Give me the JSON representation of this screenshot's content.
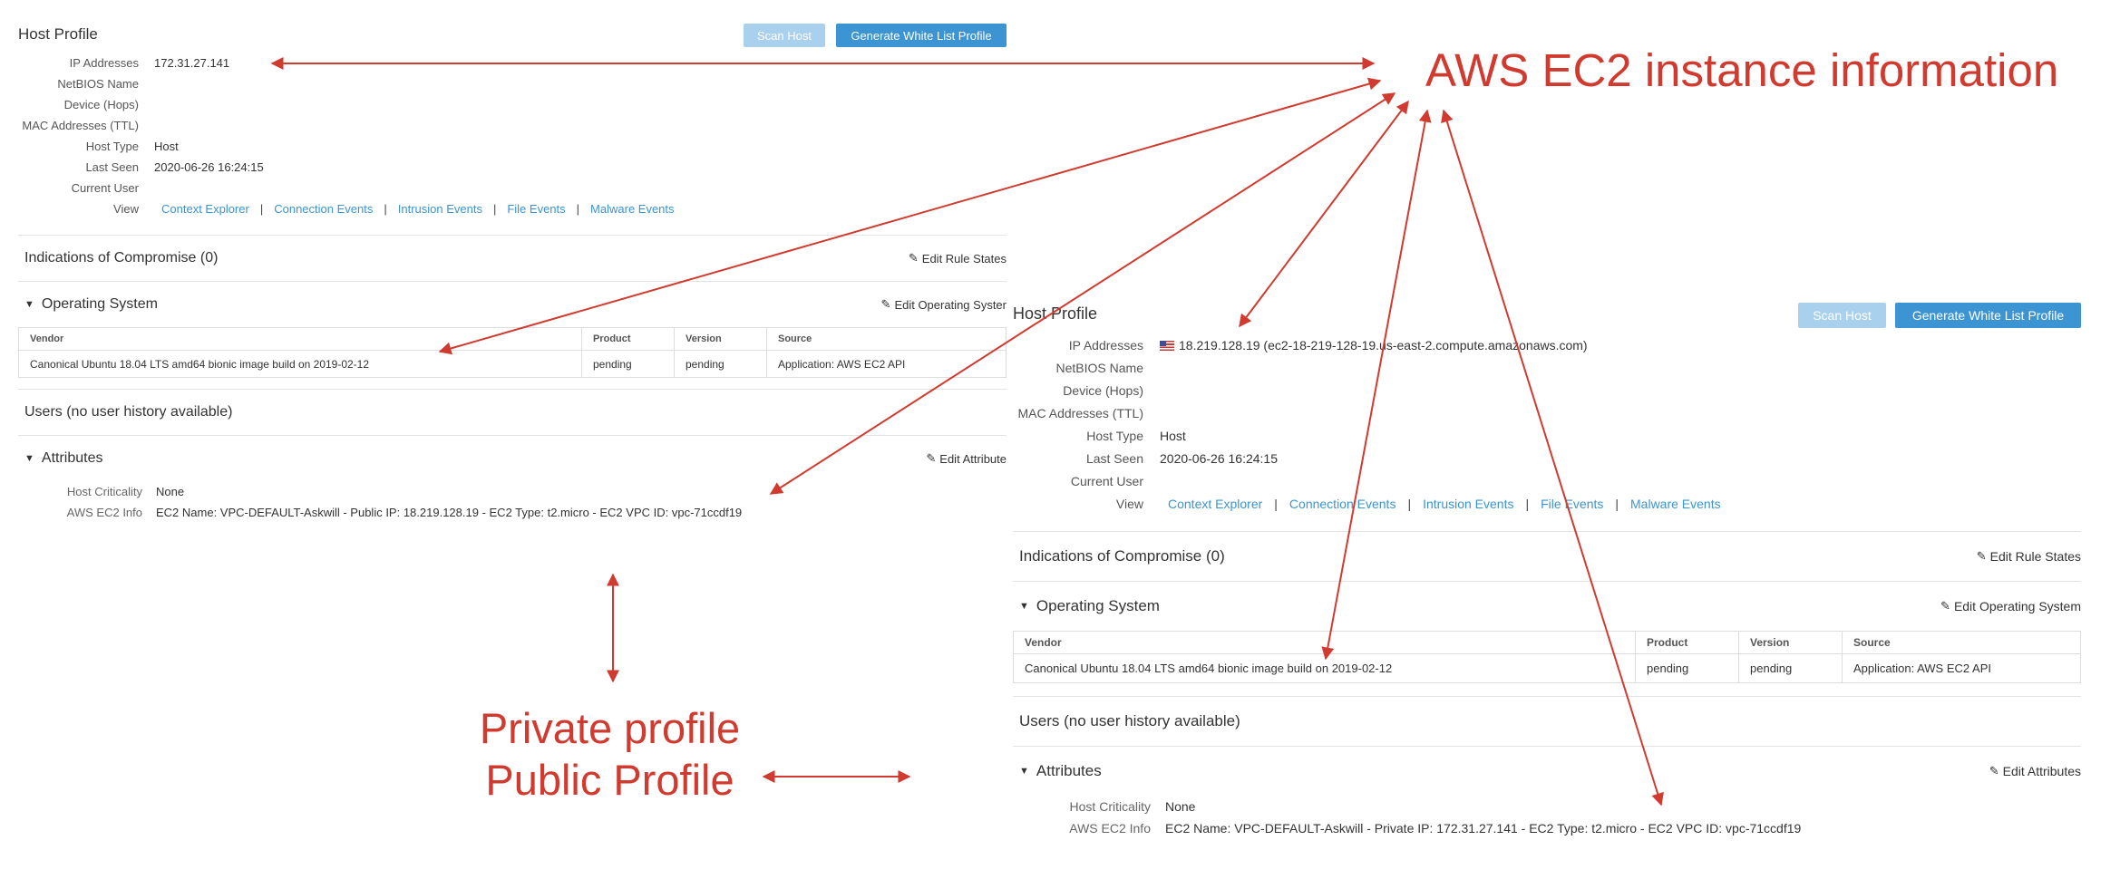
{
  "private_profile": {
    "title": "Host Profile",
    "scan_button": "Scan Host",
    "generate_button": "Generate White List Profile",
    "fields": [
      {
        "label": "IP Addresses",
        "value": "172.31.27.141"
      },
      {
        "label": "NetBIOS Name",
        "value": ""
      },
      {
        "label": "Device (Hops)",
        "value": ""
      },
      {
        "label": "MAC Addresses (TTL)",
        "value": ""
      },
      {
        "label": "Host Type",
        "value": "Host"
      },
      {
        "label": "Last Seen",
        "value": "2020-06-26 16:24:15"
      },
      {
        "label": "Current User",
        "value": ""
      }
    ],
    "view_label": "View",
    "view_links": [
      "Context Explorer",
      "Connection Events",
      "Intrusion Events",
      "File Events",
      "Malware Events"
    ],
    "separator": "|",
    "ioc": {
      "title": "Indications of Compromise (0)",
      "edit": "Edit Rule States"
    },
    "os": {
      "title": "Operating System",
      "edit": "Edit Operating Syster",
      "columns": [
        "Vendor",
        "Product",
        "Version",
        "Source"
      ],
      "rows": [
        [
          "Canonical Ubuntu 18.04 LTS amd64 bionic image build on 2019-02-12",
          "pending",
          "pending",
          "Application: AWS EC2 API"
        ]
      ]
    },
    "users": {
      "title": "Users (no user history available)"
    },
    "attributes": {
      "title": "Attributes",
      "edit": "Edit Attribute",
      "items": [
        {
          "label": "Host Criticality",
          "value": "None"
        },
        {
          "label": "AWS EC2 Info",
          "value": "EC2 Name: VPC-DEFAULT-Askwill - Public IP: 18.219.128.19 - EC2 Type: t2.micro - EC2 VPC ID: vpc-71ccdf19"
        }
      ]
    }
  },
  "public_profile": {
    "title": "Host Profile",
    "scan_button": "Scan Host",
    "generate_button": "Generate White List Profile",
    "fields": [
      {
        "label": "IP Addresses",
        "value": "18.219.128.19 (ec2-18-219-128-19.us-east-2.compute.amazonaws.com)"
      },
      {
        "label": "NetBIOS Name",
        "value": ""
      },
      {
        "label": "Device (Hops)",
        "value": ""
      },
      {
        "label": "MAC Addresses (TTL)",
        "value": ""
      },
      {
        "label": "Host Type",
        "value": "Host"
      },
      {
        "label": "Last Seen",
        "value": "2020-06-26 16:24:15"
      },
      {
        "label": "Current User",
        "value": ""
      }
    ],
    "view_label": "View",
    "view_links": [
      "Context Explorer",
      "Connection Events",
      "Intrusion Events",
      "File Events",
      "Malware Events"
    ],
    "separator": "|",
    "ioc": {
      "title": "Indications of Compromise (0)",
      "edit": "Edit Rule States"
    },
    "os": {
      "title": "Operating System",
      "edit": "Edit Operating System",
      "columns": [
        "Vendor",
        "Product",
        "Version",
        "Source"
      ],
      "rows": [
        [
          "Canonical Ubuntu 18.04 LTS amd64 bionic image build on 2019-02-12",
          "pending",
          "pending",
          "Application: AWS EC2 API"
        ]
      ]
    },
    "users": {
      "title": "Users (no user history available)"
    },
    "attributes": {
      "title": "Attributes",
      "edit": "Edit Attributes",
      "items": [
        {
          "label": "Host Criticality",
          "value": "None"
        },
        {
          "label": "AWS EC2 Info",
          "value": "EC2 Name: VPC-DEFAULT-Askwill - Private IP: 172.31.27.141 - EC2 Type: t2.micro - EC2 VPC ID: vpc-71ccdf19"
        }
      ]
    }
  },
  "annotations": {
    "aws_title": "AWS EC2 instance information",
    "private_label": "Private profile",
    "public_label": "Public Profile",
    "arrow_color": "#d13a2f"
  },
  "colors": {
    "link": "#3c94d3",
    "button_primary": "#3c94d3",
    "button_disabled": "#a9d0ec"
  },
  "icons": {
    "edit": "pencil-icon",
    "collapse": "triangle-down-icon",
    "flag": "us-flag-icon"
  }
}
